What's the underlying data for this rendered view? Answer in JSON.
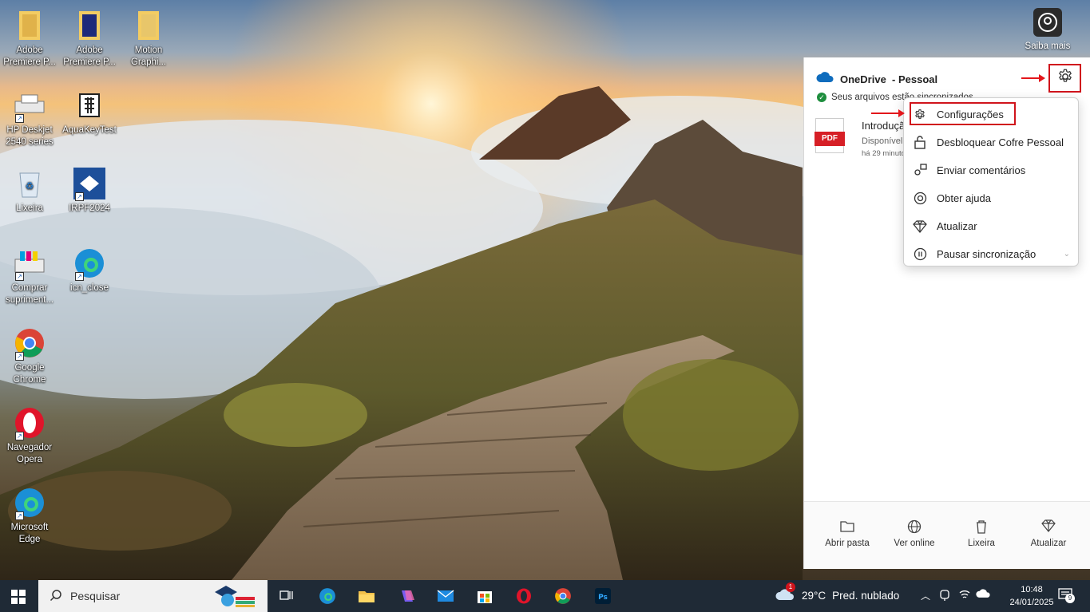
{
  "desktop": {
    "icons": [
      {
        "label": "Adobe Premiere P...",
        "icon": "folder-icon"
      },
      {
        "label": "Adobe Premiere P...",
        "icon": "folder-icon"
      },
      {
        "label": "Motion Graphi...",
        "icon": "folder-icon"
      },
      {
        "label": "HP Deskjet 2540 series",
        "icon": "printer-icon"
      },
      {
        "label": "AquaKeyTest",
        "icon": "app-icon"
      },
      {
        "label": "Lixeira",
        "icon": "recycle-bin-icon"
      },
      {
        "label": "IRPF2024",
        "icon": "irpf-icon"
      },
      {
        "label": "Comprar supriment...",
        "icon": "printer-icon"
      },
      {
        "label": "icn_close",
        "icon": "edge-icon"
      },
      {
        "label": "Google Chrome",
        "icon": "chrome-icon"
      },
      {
        "label": "Navegador Opera",
        "icon": "opera-icon"
      },
      {
        "label": "Microsoft Edge",
        "icon": "edge-icon"
      }
    ],
    "saiba_mais": "Saiba mais"
  },
  "onedrive": {
    "title": "OneDrive",
    "account": "- Pessoal",
    "status": "Seus arquivos estão sincronizados",
    "file": {
      "name": "Introdução",
      "availability": "Disponível",
      "time": "há 29 minutos"
    },
    "menu": [
      {
        "label": "Configurações",
        "icon": "gear-icon"
      },
      {
        "label": "Desbloquear Cofre Pessoal",
        "icon": "lock-icon"
      },
      {
        "label": "Enviar comentários",
        "icon": "feedback-icon"
      },
      {
        "label": "Obter ajuda",
        "icon": "help-icon"
      },
      {
        "label": "Atualizar",
        "icon": "diamond-icon"
      },
      {
        "label": "Pausar sincronização",
        "icon": "pause-icon"
      }
    ],
    "footer": [
      {
        "label": "Abrir pasta",
        "icon": "folder-icon"
      },
      {
        "label": "Ver online",
        "icon": "globe-icon"
      },
      {
        "label": "Lixeira",
        "icon": "trash-icon"
      },
      {
        "label": "Atualizar",
        "icon": "diamond-icon"
      }
    ]
  },
  "taskbar": {
    "search_placeholder": "Pesquisar",
    "weather": {
      "temp": "29°C",
      "desc": "Pred. nublado",
      "alert": "1"
    },
    "time": "10:48",
    "date": "24/01/2025",
    "notifications": "9"
  },
  "colors": {
    "accent_red": "#d0141c",
    "onedrive_blue": "#0f6cbd",
    "taskbar": "#1f2a36"
  }
}
